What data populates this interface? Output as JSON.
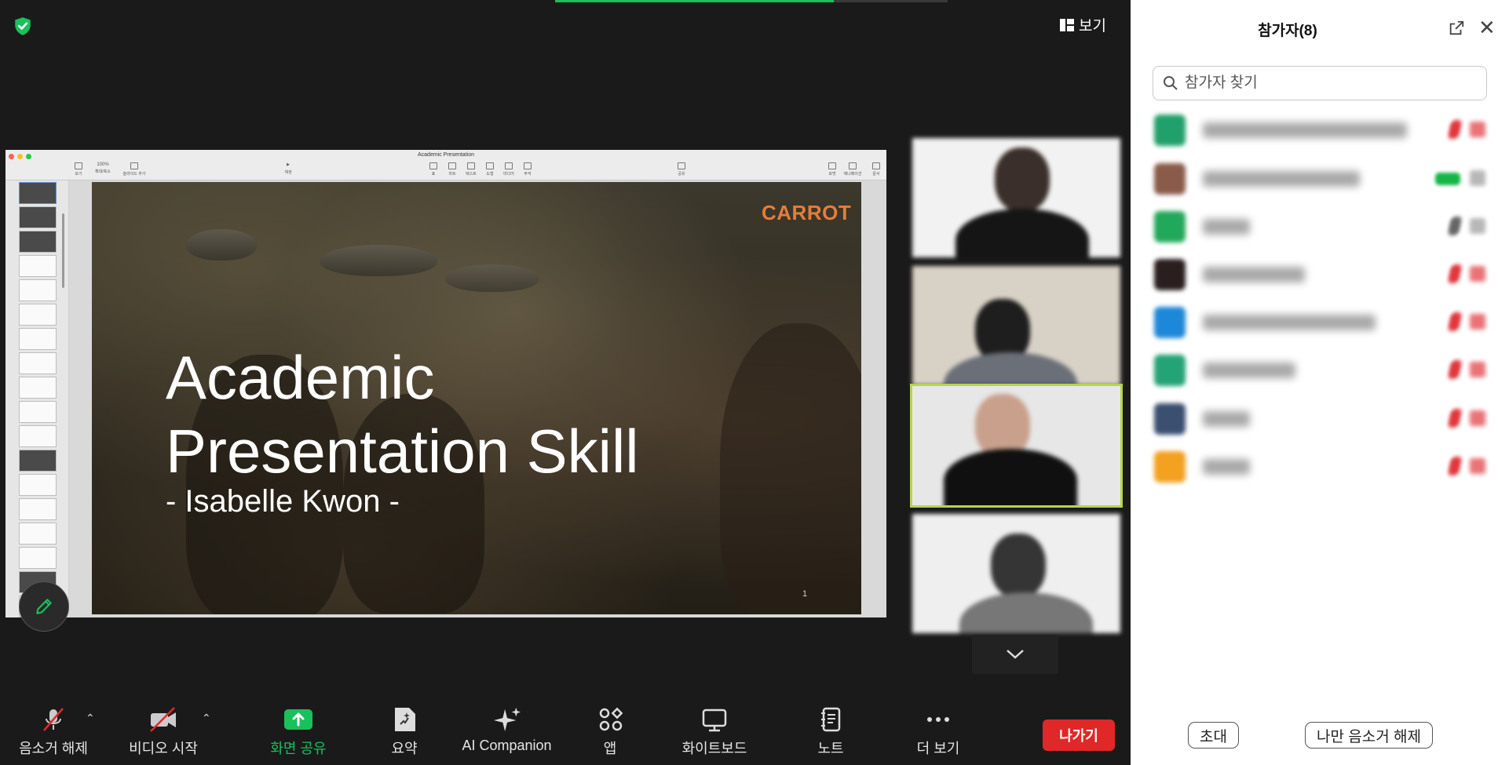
{
  "meeting": {
    "view_label": "보기",
    "security_icon": "shield-check-icon",
    "security_color": "#19c05c"
  },
  "shared_screen": {
    "window_title": "Academic Presentation",
    "zoom": "100%",
    "toolbar_items": [
      "보기",
      "확대/축소",
      "슬라이드 추가",
      "재생",
      "표",
      "차트",
      "텍스트",
      "도형",
      "미디어",
      "주석",
      "공유",
      "포맷",
      "애니메이션",
      "문서"
    ],
    "slide": {
      "title_line1": "Academic",
      "title_line2": "Presentation Skill",
      "subtitle": "- Isabelle Kwon -",
      "brand": "CARROT",
      "page_number": "1",
      "brand_color": "#e57d3c"
    }
  },
  "toolbar": {
    "mute_label": "음소거 해제",
    "video_label": "비디오 시작",
    "share_label": "화면 공유",
    "summary_label": "요약",
    "ai_label": "AI Companion",
    "apps_label": "앱",
    "whiteboard_label": "화이트보드",
    "notes_label": "노트",
    "more_label": "더 보기",
    "leave_label": "나가기",
    "share_color": "#19c05c",
    "leave_color": "#e02828"
  },
  "participants_panel": {
    "title": "참가자(8)",
    "search_placeholder": "참가자 찾기",
    "invite_label": "초대",
    "unmute_me_label": "나만 음소거 해제",
    "participants": [
      {
        "avatar_color": "#22a06b"
      },
      {
        "avatar_color": "#8a5b48"
      },
      {
        "avatar_color": "#22a85a"
      },
      {
        "avatar_color": "#2a1e1e"
      },
      {
        "avatar_color": "#1e88d8"
      },
      {
        "avatar_color": "#24a376"
      },
      {
        "avatar_color": "#3b4f70"
      },
      {
        "avatar_color": "#f4a020"
      }
    ]
  }
}
